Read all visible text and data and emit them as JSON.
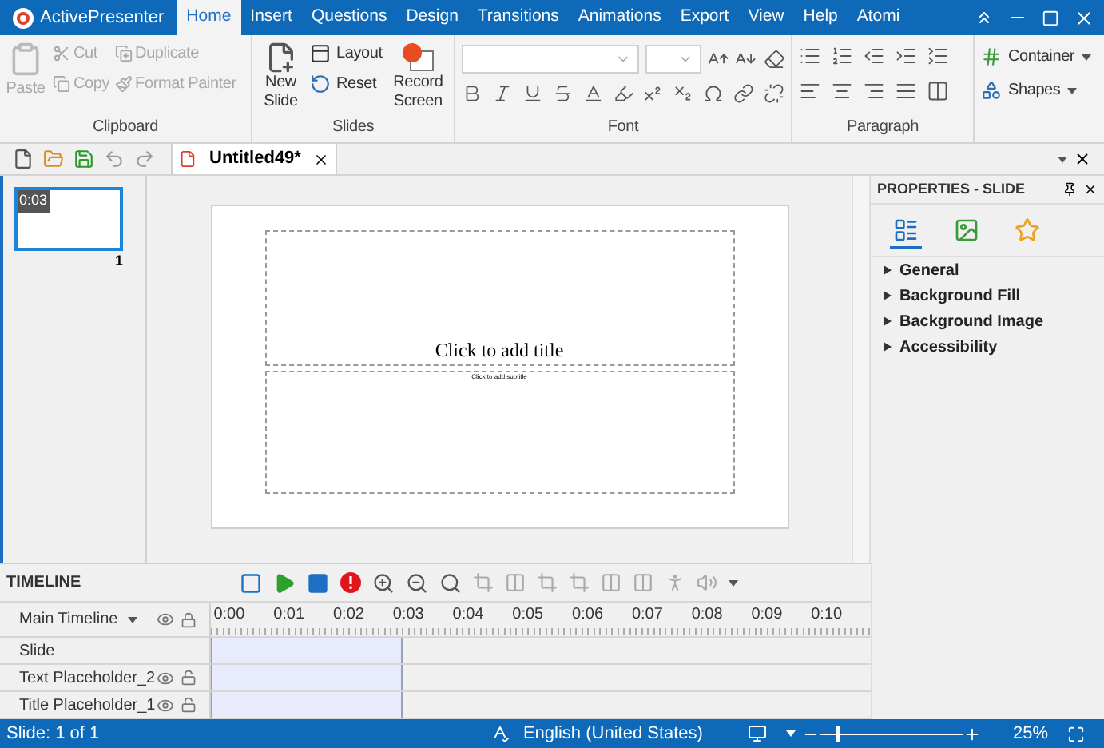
{
  "app": {
    "name": "ActivePresenter"
  },
  "menu_tabs": [
    {
      "label": "Home",
      "selected": true
    },
    {
      "label": "Insert",
      "selected": false
    },
    {
      "label": "Questions",
      "selected": false
    },
    {
      "label": "Design",
      "selected": false
    },
    {
      "label": "Transitions",
      "selected": false
    },
    {
      "label": "Animations",
      "selected": false
    },
    {
      "label": "Export",
      "selected": false
    },
    {
      "label": "View",
      "selected": false
    },
    {
      "label": "Help",
      "selected": false
    },
    {
      "label": "Atomi",
      "selected": false
    }
  ],
  "clipboard": {
    "label": "Clipboard",
    "paste": {
      "label": "Paste",
      "disabled": true
    },
    "cut": {
      "label": "Cut",
      "disabled": true
    },
    "copy": {
      "label": "Copy",
      "disabled": true
    },
    "duplicate": {
      "label": "Duplicate",
      "disabled": true
    },
    "format_painter": {
      "label": "Format Painter",
      "disabled": true
    }
  },
  "slides": {
    "label": "Slides",
    "new_slide": "New Slide",
    "layout": "Layout",
    "reset": "Reset",
    "record_screen": "Record Screen"
  },
  "font": {
    "label": "Font"
  },
  "paragraph": {
    "label": "Paragraph"
  },
  "insert": {
    "container": "Container",
    "shapes": "Shapes"
  },
  "document_tab": {
    "title": "Untitled49*"
  },
  "thumbnails": [
    {
      "duration": "0:03",
      "number": "1",
      "selected": true
    }
  ],
  "slide": {
    "title_placeholder": "Click to add title",
    "subtitle_placeholder": "Click to add subtitle"
  },
  "properties": {
    "title": "PROPERTIES - SLIDE",
    "icon_tabs": [
      {
        "selected": true
      },
      {
        "selected": false
      },
      {
        "selected": false
      }
    ],
    "sections": [
      {
        "label": "General",
        "expanded": false
      },
      {
        "label": "Background Fill",
        "expanded": false
      },
      {
        "label": "Background Image",
        "expanded": false
      },
      {
        "label": "Accessibility",
        "expanded": false
      }
    ]
  },
  "timeline": {
    "title": "TIMELINE",
    "main": "Main Timeline",
    "ticks": [
      "0:00",
      "0:01",
      "0:02",
      "0:03",
      "0:04",
      "0:05",
      "0:06",
      "0:07",
      "0:08",
      "0:09",
      "0:10"
    ],
    "clip": {
      "level": 0.3
    },
    "rows": [
      {
        "name": "Slide",
        "controls": false
      },
      {
        "name": "Text Placeholder_2",
        "controls": true
      },
      {
        "name": "Title Placeholder_1",
        "controls": true
      }
    ]
  },
  "status_bar": {
    "slide": "Slide: 1 of 1",
    "language": "English (United States)",
    "zoom": {
      "level": 0.12
    },
    "zoom_reading": "25%"
  }
}
